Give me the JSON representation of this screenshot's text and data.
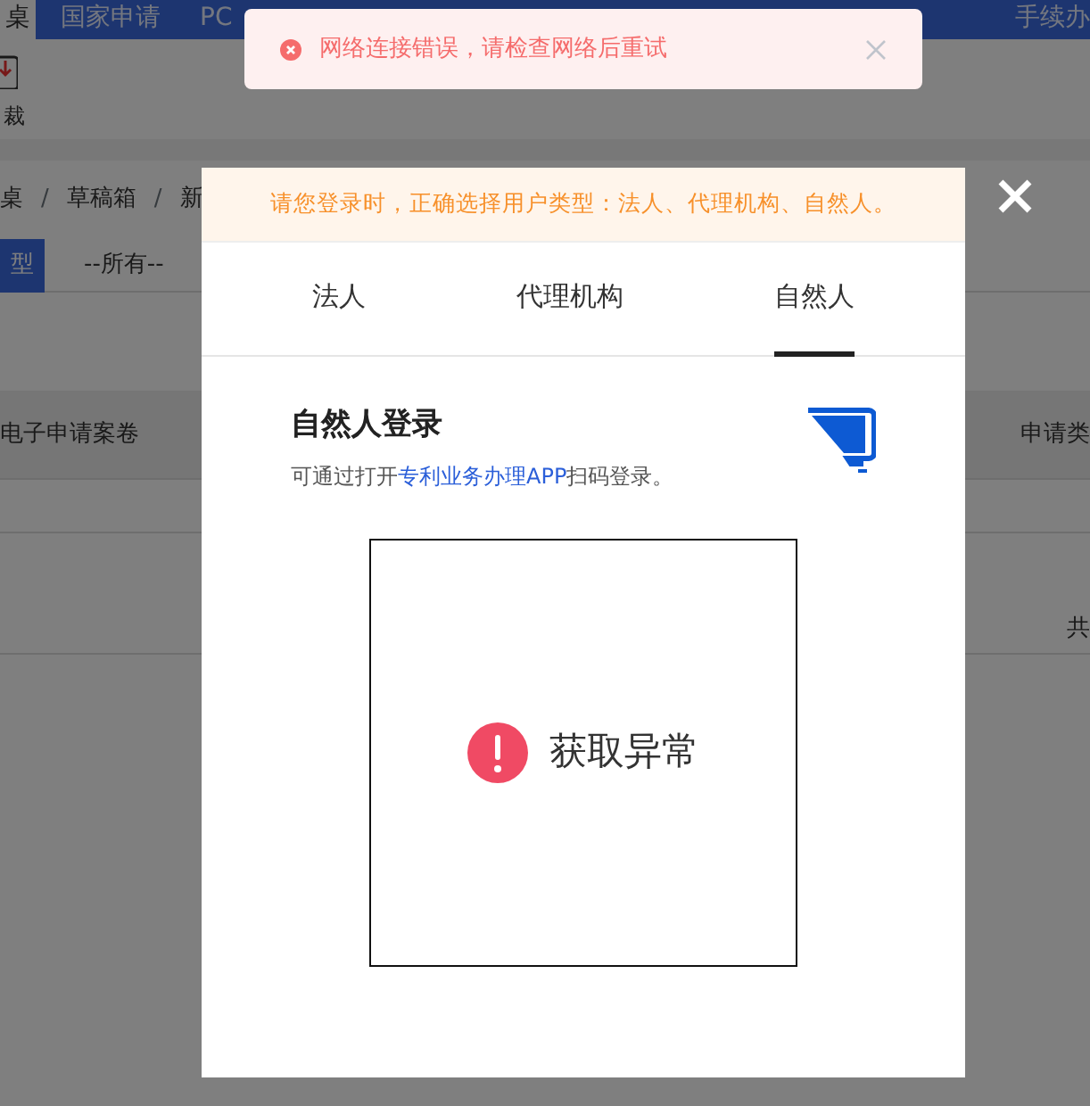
{
  "background": {
    "nav_tabs": [
      {
        "label": "桌",
        "selected": true
      },
      {
        "label": "国家申请",
        "selected": false
      },
      {
        "label": "PC",
        "selected": false
      },
      {
        "label": "手续办",
        "selected": false
      }
    ],
    "toolbar_button": {
      "label": "裁"
    },
    "breadcrumb": {
      "separator": "/",
      "items": [
        "桌",
        "草稿箱",
        "新"
      ]
    },
    "filter": {
      "label": "型",
      "value": "--所有--"
    },
    "table": {
      "columns": [
        "电子申请案卷",
        "申请类"
      ]
    },
    "pager_text": "共"
  },
  "toast": {
    "kind": "error",
    "message": "网络连接错误，请检查网络后重试"
  },
  "dialog": {
    "notice": "请您登录时，正确选择用户类型：法人、代理机构、自然人。",
    "tabs": [
      {
        "label": "法人",
        "selected": false
      },
      {
        "label": "代理机构",
        "selected": false
      },
      {
        "label": "自然人",
        "selected": true
      }
    ],
    "title": "自然人登录",
    "description": {
      "before": "可通过打开",
      "link": "专利业务办理APP",
      "after": "扫码登录。"
    },
    "qr": {
      "kind": "error",
      "message": "获取异常"
    }
  }
}
